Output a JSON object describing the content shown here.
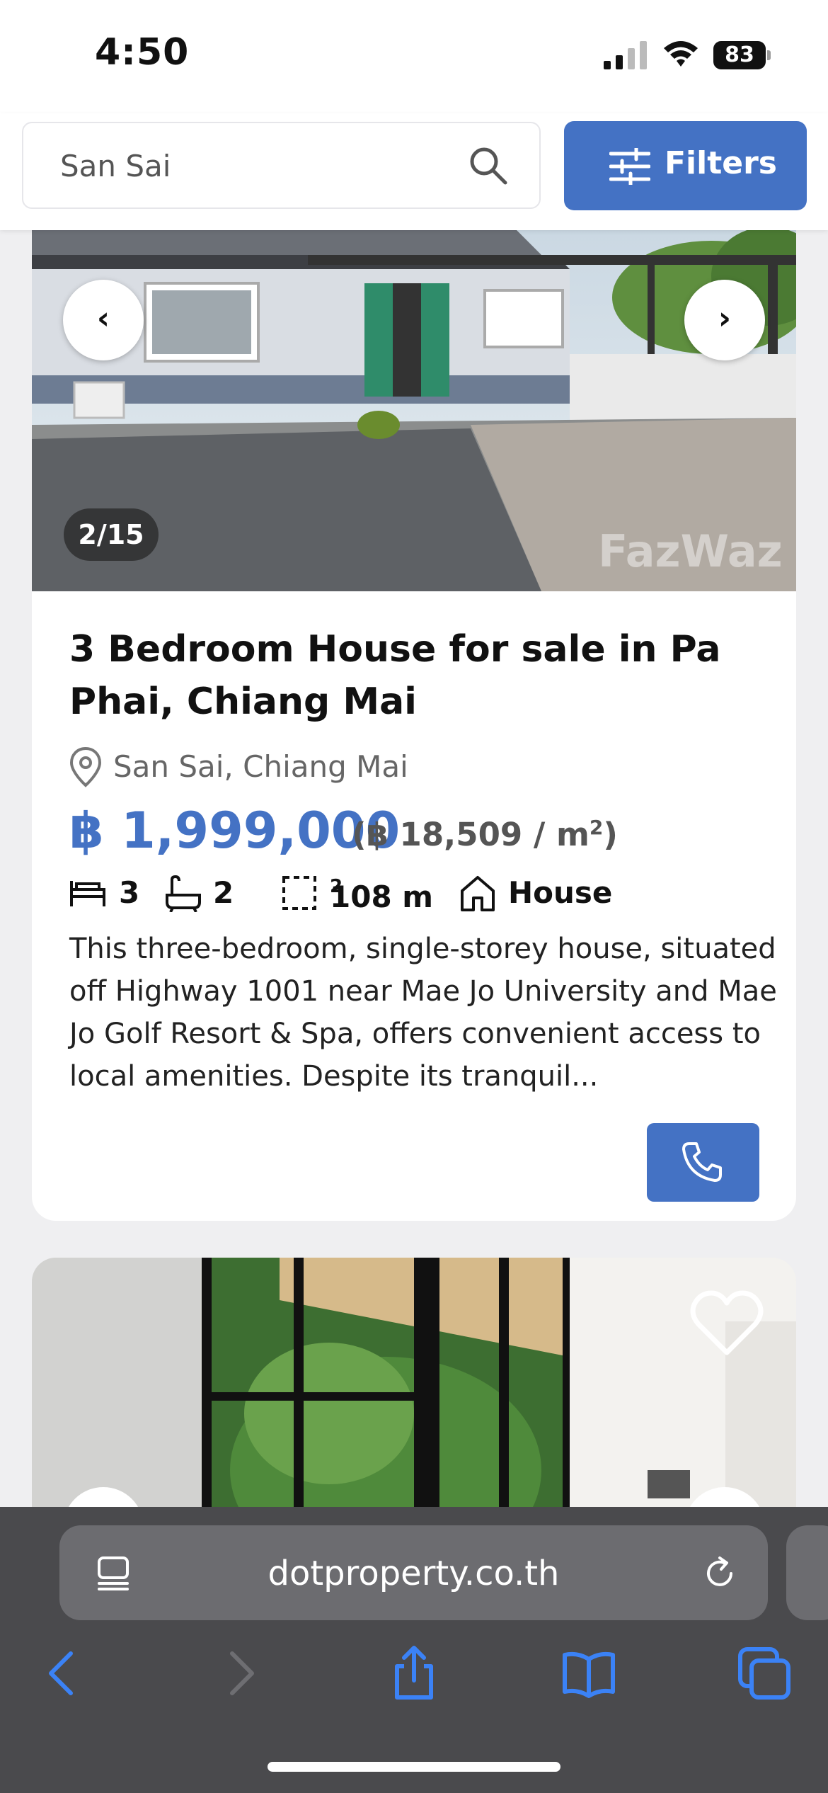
{
  "status_bar": {
    "time": "4:50",
    "battery": "83"
  },
  "search": {
    "value": "San Sai",
    "filters_label": "Filters"
  },
  "listing1": {
    "image_counter": "2/15",
    "watermark": "FazWaz",
    "title": "3 Bedroom House for sale in Pa Phai, Chiang Mai",
    "location": "San Sai, Chiang Mai",
    "price": "฿ 1,999,000",
    "price_per_sqm_prefix": "(฿ 18,509 / m",
    "price_per_sqm_suffix": ")",
    "bedrooms": "3",
    "bathrooms": "2",
    "area": "108 m",
    "type": "House",
    "description": "This three-bedroom, single-storey house, situated off Highway 1001 near Mae Jo University and Mae Jo Golf Resort & Spa, offers convenient access to local amenities. Despite its tranquil..."
  },
  "browser": {
    "url": "dotproperty.co.th"
  },
  "icons": {
    "prev": "chevron-left-icon",
    "next": "chevron-right-icon",
    "call": "phone-icon",
    "favorite": "heart-icon"
  },
  "colors": {
    "accent": "#4472c4",
    "ios_blue": "#3b82f6"
  }
}
